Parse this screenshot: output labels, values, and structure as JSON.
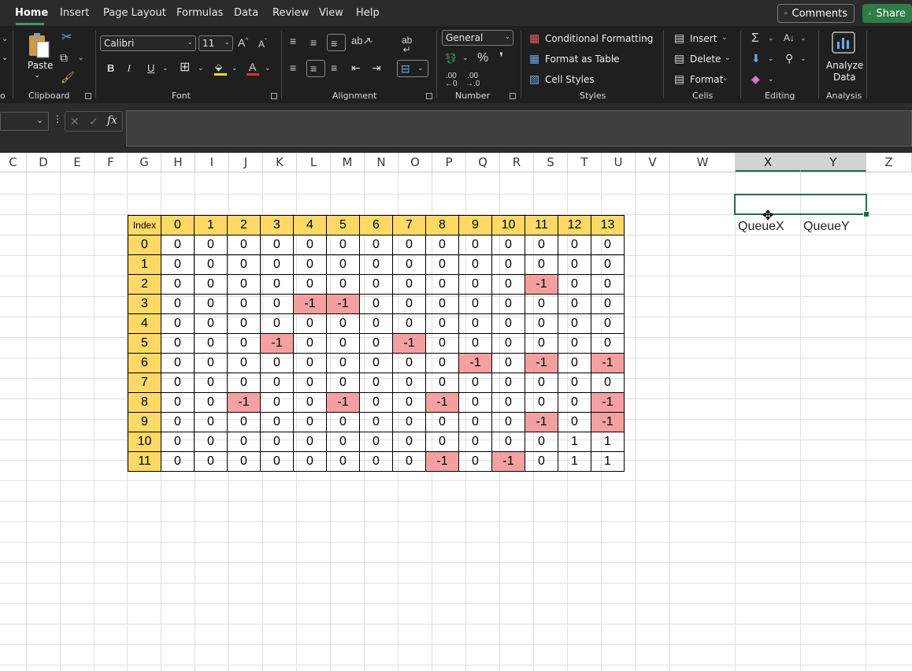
{
  "menu": {
    "tabs": [
      "Home",
      "Insert",
      "Page Layout",
      "Formulas",
      "Data",
      "Review",
      "View",
      "Help"
    ],
    "active_tab": "Home",
    "comments_label": "Comments",
    "share_label": "Share"
  },
  "ribbon": {
    "clipboard": {
      "paste_label": "Paste",
      "group_label": "Clipboard"
    },
    "font": {
      "font_name": "Calibri",
      "font_size": "11",
      "group_label": "Font"
    },
    "alignment": {
      "group_label": "Alignment"
    },
    "number": {
      "format": "General",
      "group_label": "Number"
    },
    "styles": {
      "conditional_formatting": "Conditional Formatting",
      "format_as_table": "Format as Table",
      "cell_styles": "Cell Styles",
      "group_label": "Styles"
    },
    "cells": {
      "insert": "Insert",
      "delete": "Delete",
      "format": "Format",
      "group_label": "Cells"
    },
    "editing": {
      "group_label": "Editing"
    },
    "analysis": {
      "analyze_data_line1": "Analyze",
      "analyze_data_line2": "Data",
      "group_label": "Analysis"
    },
    "left_clip_label": "o"
  },
  "formula_bar": {
    "fx_label": "fx",
    "content": ""
  },
  "sheet": {
    "columns": [
      "C",
      "D",
      "E",
      "F",
      "G",
      "H",
      "I",
      "J",
      "K",
      "L",
      "M",
      "N",
      "O",
      "P",
      "Q",
      "R",
      "S",
      "T",
      "U",
      "V",
      "W",
      "X",
      "Y",
      "Z"
    ],
    "selected_columns": [
      "X",
      "Y"
    ],
    "table": {
      "header": [
        "Index",
        "0",
        "1",
        "2",
        "3",
        "4",
        "5",
        "6",
        "7",
        "8",
        "9",
        "10",
        "11",
        "12",
        "13"
      ],
      "rows": [
        [
          "0",
          "0",
          "0",
          "0",
          "0",
          "0",
          "0",
          "0",
          "0",
          "0",
          "0",
          "0",
          "0",
          "0",
          "0"
        ],
        [
          "1",
          "0",
          "0",
          "0",
          "0",
          "0",
          "0",
          "0",
          "0",
          "0",
          "0",
          "0",
          "0",
          "0",
          "0"
        ],
        [
          "2",
          "0",
          "0",
          "0",
          "0",
          "0",
          "0",
          "0",
          "0",
          "0",
          "0",
          "0",
          "-1",
          "0",
          "0"
        ],
        [
          "3",
          "0",
          "0",
          "0",
          "0",
          "-1",
          "-1",
          "0",
          "0",
          "0",
          "0",
          "0",
          "0",
          "0",
          "0"
        ],
        [
          "4",
          "0",
          "0",
          "0",
          "0",
          "0",
          "0",
          "0",
          "0",
          "0",
          "0",
          "0",
          "0",
          "0",
          "0"
        ],
        [
          "5",
          "0",
          "0",
          "0",
          "-1",
          "0",
          "0",
          "0",
          "-1",
          "0",
          "0",
          "0",
          "0",
          "0",
          "0"
        ],
        [
          "6",
          "0",
          "0",
          "0",
          "0",
          "0",
          "0",
          "0",
          "0",
          "0",
          "-1",
          "0",
          "-1",
          "0",
          "-1"
        ],
        [
          "7",
          "0",
          "0",
          "0",
          "0",
          "0",
          "0",
          "0",
          "0",
          "0",
          "0",
          "0",
          "0",
          "0",
          "0"
        ],
        [
          "8",
          "0",
          "0",
          "-1",
          "0",
          "0",
          "-1",
          "0",
          "0",
          "-1",
          "0",
          "0",
          "0",
          "0",
          "-1"
        ],
        [
          "9",
          "0",
          "0",
          "0",
          "0",
          "0",
          "0",
          "0",
          "0",
          "0",
          "0",
          "0",
          "-1",
          "0",
          "-1"
        ],
        [
          "10",
          "0",
          "0",
          "0",
          "0",
          "0",
          "0",
          "0",
          "0",
          "0",
          "0",
          "0",
          "0",
          "1",
          "1"
        ],
        [
          "11",
          "0",
          "0",
          "0",
          "0",
          "0",
          "0",
          "0",
          "0",
          "-1",
          "0",
          "-1",
          "0",
          "1",
          "1"
        ]
      ]
    },
    "queue_x_label": "QueueX",
    "queue_y_label": "QueueY"
  },
  "colors": {
    "header_fill": "#ffd966",
    "negative_fill": "#f4a0a0",
    "selection_border": "#1e6f41",
    "share_green": "#2e7d45"
  }
}
